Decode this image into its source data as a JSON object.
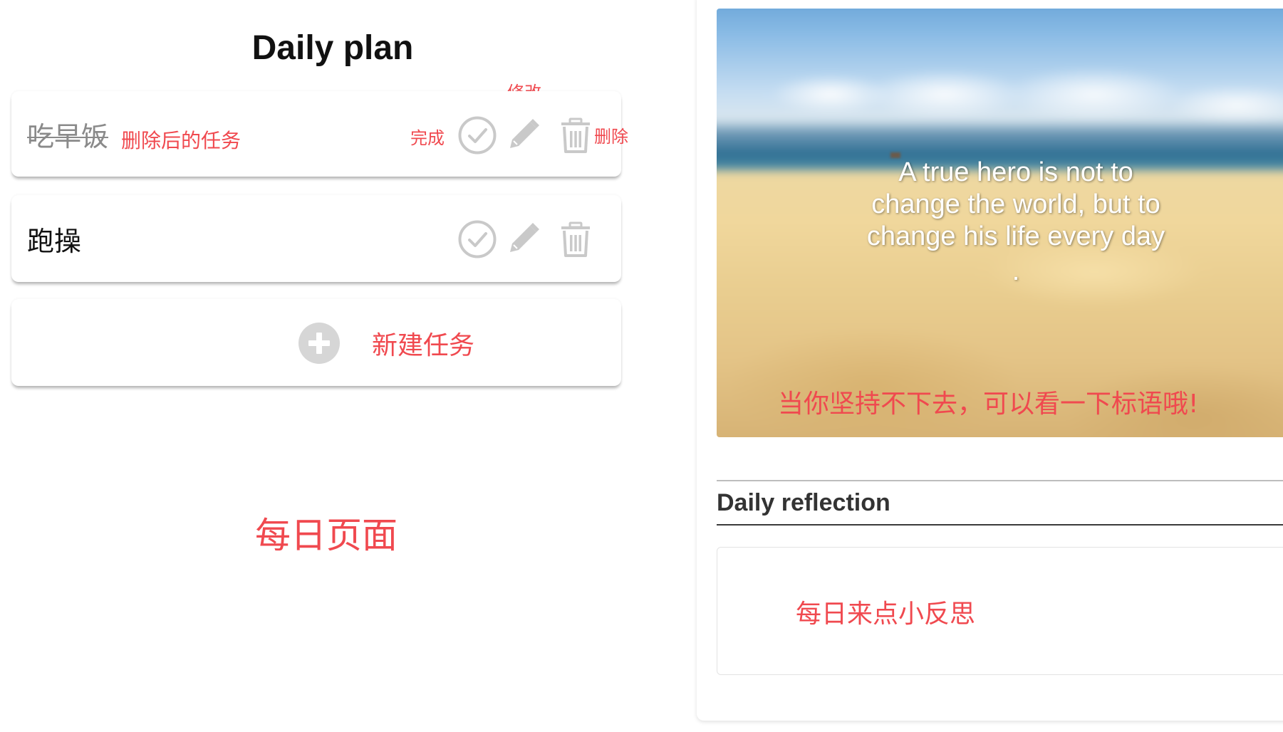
{
  "plan": {
    "title": "Daily plan",
    "tasks": [
      {
        "name": "吃早饭",
        "status": "deleted"
      },
      {
        "name": "跑操",
        "status": "active"
      }
    ],
    "add_label": "新建任务"
  },
  "annotations": {
    "edit": "修改",
    "deleted_task": "删除后的任务",
    "complete": "完成",
    "delete": "删除",
    "daily_page": "每日页面",
    "slogan_hint": "当你坚持不下去，可以看一下标语哦!",
    "reflection_hint": "每日来点小反思"
  },
  "banner": {
    "quote": "A true hero is not to change the world, but to change his life every day",
    "quote_tail": "."
  },
  "reflection": {
    "title": "Daily reflection"
  },
  "colors": {
    "annotation": "#f0494f",
    "icon_gray": "#c9c9c9"
  }
}
